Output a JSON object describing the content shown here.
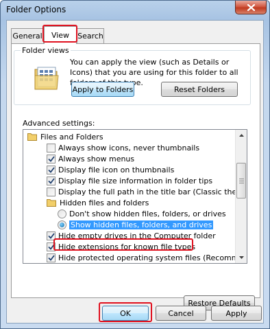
{
  "window": {
    "title": "Folder Options",
    "close_label": "close"
  },
  "tabs": [
    {
      "label": "General"
    },
    {
      "label": "View"
    },
    {
      "label": "Search"
    }
  ],
  "folder_views": {
    "label": "Folder views",
    "description": "You can apply the view (such as Details or Icons) that you are using for this folder to all folders of this type.",
    "apply_button": "Apply to Folders",
    "reset_button": "Reset Folders"
  },
  "advanced": {
    "label": "Advanced settings:",
    "items": [
      {
        "type": "folder",
        "label": "Files and Folders"
      },
      {
        "type": "checkbox",
        "label": "Always show icons, never thumbnails",
        "checked": false
      },
      {
        "type": "checkbox",
        "label": "Always show menus",
        "checked": true
      },
      {
        "type": "checkbox",
        "label": "Display file icon on thumbnails",
        "checked": true
      },
      {
        "type": "checkbox",
        "label": "Display file size information in folder tips",
        "checked": true
      },
      {
        "type": "checkbox",
        "label": "Display the full path in the title bar (Classic theme only)",
        "checked": false
      },
      {
        "type": "folder",
        "label": "Hidden files and folders"
      },
      {
        "type": "radio",
        "label": "Don't show hidden files, folders, or drives",
        "checked": false
      },
      {
        "type": "radio",
        "label": "Show hidden files, folders, and drives",
        "checked": true
      },
      {
        "type": "checkbox",
        "label": "Hide empty drives in the Computer folder",
        "checked": true
      },
      {
        "type": "checkbox",
        "label": "Hide extensions for known file types",
        "checked": true
      },
      {
        "type": "checkbox",
        "label": "Hide protected operating system files (Recommended)",
        "checked": true
      }
    ]
  },
  "buttons": {
    "restore": "Restore Defaults",
    "ok": "OK",
    "cancel": "Cancel",
    "apply": "Apply"
  },
  "colors": {
    "highlight_box": "#e0101e",
    "selection": "#3399ff"
  }
}
